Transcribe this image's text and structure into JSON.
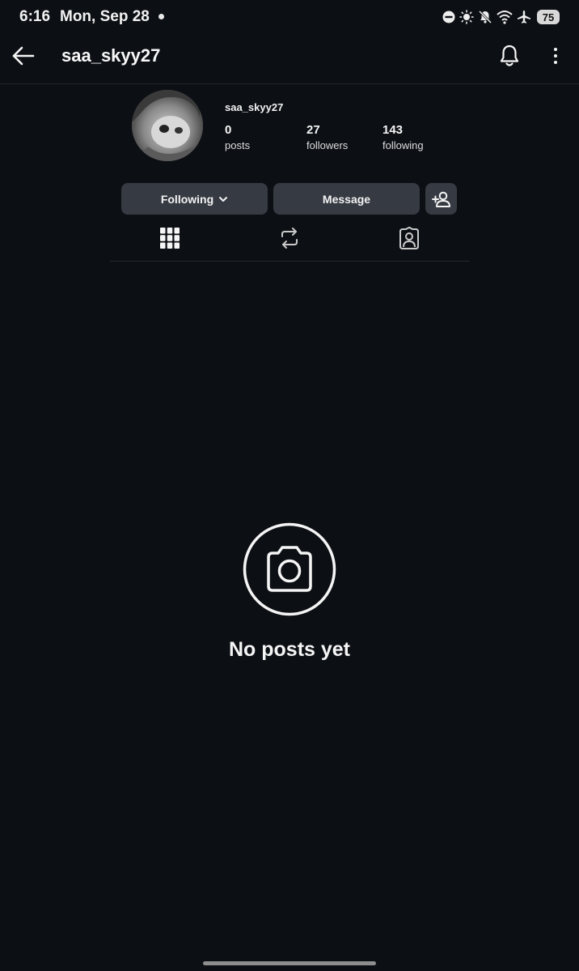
{
  "status_bar": {
    "time": "6:16",
    "date": "Mon, Sep 28",
    "battery": "75",
    "icons": [
      "do-not-disturb-icon",
      "brightness-icon",
      "mute-icon",
      "wifi-icon",
      "airplane-icon",
      "battery-icon"
    ]
  },
  "header": {
    "username": "saa_skyy27",
    "icons": [
      "back-arrow-icon",
      "bell-icon",
      "more-vertical-icon"
    ]
  },
  "profile": {
    "name": "saa_skyy27",
    "stats": [
      {
        "value": "0",
        "label": "posts"
      },
      {
        "value": "27",
        "label": "followers"
      },
      {
        "value": "143",
        "label": "following"
      }
    ]
  },
  "actions": {
    "following_label": "Following",
    "message_label": "Message"
  },
  "tabs": [
    {
      "icon": "grid-icon"
    },
    {
      "icon": "repost-icon"
    },
    {
      "icon": "tagged-icon"
    }
  ],
  "empty_state": {
    "text": "No posts yet",
    "icon": "camera-icon"
  },
  "colors": {
    "background": "#0c0f14",
    "button": "#363a42",
    "text": "#f5f5f5"
  }
}
